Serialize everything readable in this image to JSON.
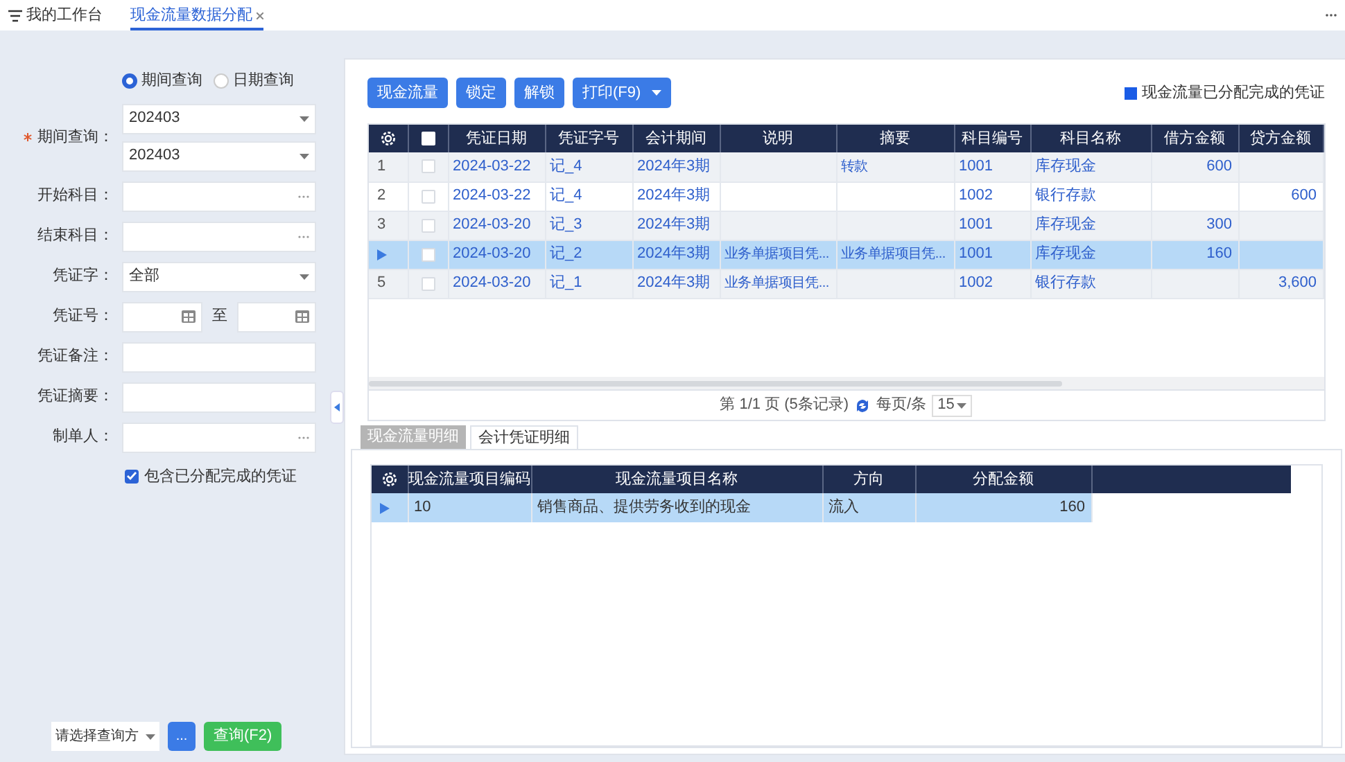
{
  "tabs": [
    {
      "label": "我的工作台",
      "selected": false,
      "kind": "menu"
    },
    {
      "label": "现金流量数据分配",
      "selected": true,
      "kind": "closable"
    }
  ],
  "query_mode": [
    {
      "label": "期间查询",
      "selected": true
    },
    {
      "label": "日期查询",
      "selected": false
    }
  ],
  "form": [
    {
      "kind": "select_pair",
      "label": "期间查询：",
      "required": true,
      "values": [
        "202403",
        "202403"
      ]
    },
    {
      "kind": "lookup",
      "label": "开始科目："
    },
    {
      "kind": "lookup",
      "label": "结束科目："
    },
    {
      "kind": "select",
      "label": "凭证字：",
      "value": "全部"
    },
    {
      "kind": "range",
      "label": "凭证号：",
      "separator": "至"
    },
    {
      "kind": "text",
      "label": "凭证备注："
    },
    {
      "kind": "text",
      "label": "凭证摘要："
    },
    {
      "kind": "lookup",
      "label": "制单人："
    }
  ],
  "include_completed": {
    "label": "包含已分配完成的凭证",
    "checked": true
  },
  "footer": {
    "scheme_placeholder": "请选择查询方",
    "more_button": "...",
    "query_button": "查询(F2)"
  },
  "toolbar": [
    {
      "label": "现金流量",
      "kind": "button"
    },
    {
      "label": "锁定",
      "kind": "button"
    },
    {
      "label": "解锁",
      "kind": "button"
    },
    {
      "label": "打印(F9)",
      "kind": "split"
    }
  ],
  "legend": {
    "label": "现金流量已分配完成的凭证",
    "color": "#1a5ce6"
  },
  "voucher_table": {
    "all_checked": false,
    "columns": [
      {
        "label": "凭证日期",
        "kind": "text"
      },
      {
        "label": "凭证字号",
        "kind": "text"
      },
      {
        "label": "会计期间",
        "kind": "text"
      },
      {
        "label": "说明",
        "kind": "text"
      },
      {
        "label": "摘要",
        "kind": "text"
      },
      {
        "label": "科目编号",
        "kind": "text"
      },
      {
        "label": "科目名称",
        "kind": "text"
      },
      {
        "label": "借方金额",
        "kind": "amount"
      },
      {
        "label": "贷方金额",
        "kind": "amount"
      }
    ],
    "rows": [
      {
        "no": "1",
        "checked": false,
        "selected": false,
        "cells": [
          "2024-03-22",
          "记_4",
          "2024年3期",
          "",
          "转款",
          "1001",
          "库存现金",
          "600",
          ""
        ]
      },
      {
        "no": "2",
        "checked": false,
        "selected": false,
        "cells": [
          "2024-03-22",
          "记_4",
          "2024年3期",
          "",
          "",
          "1002",
          "银行存款",
          "",
          "600"
        ]
      },
      {
        "no": "3",
        "checked": false,
        "selected": false,
        "cells": [
          "2024-03-20",
          "记_3",
          "2024年3期",
          "",
          "",
          "1001",
          "库存现金",
          "300",
          ""
        ]
      },
      {
        "checked": false,
        "selected": true,
        "cells": [
          "2024-03-20",
          "记_2",
          "2024年3期",
          "业务单据项目凭...",
          "业务单据项目凭...",
          "1001",
          "库存现金",
          "160",
          ""
        ]
      },
      {
        "no": "5",
        "checked": false,
        "selected": false,
        "cells": [
          "2024-03-20",
          "记_1",
          "2024年3期",
          "业务单据项目凭...",
          "",
          "1002",
          "银行存款",
          "",
          "3,600"
        ]
      }
    ]
  },
  "pager": {
    "text": "第 1/1 页 (5条记录)",
    "per_page_label": "每页/条",
    "per_page": "15"
  },
  "detail_tabs": [
    {
      "label": "现金流量明细",
      "selected": true
    },
    {
      "label": "会计凭证明细",
      "selected": false
    }
  ],
  "detail_table": {
    "columns": [
      {
        "label": "现金流量项目编码",
        "kind": "text"
      },
      {
        "label": "现金流量项目名称",
        "kind": "text"
      },
      {
        "label": "方向",
        "kind": "text"
      },
      {
        "label": "分配金额",
        "kind": "amount"
      }
    ],
    "rows": [
      {
        "selected": true,
        "cells": [
          "10",
          "销售商品、提供劳务收到的现金",
          "流入",
          "160"
        ]
      }
    ]
  }
}
